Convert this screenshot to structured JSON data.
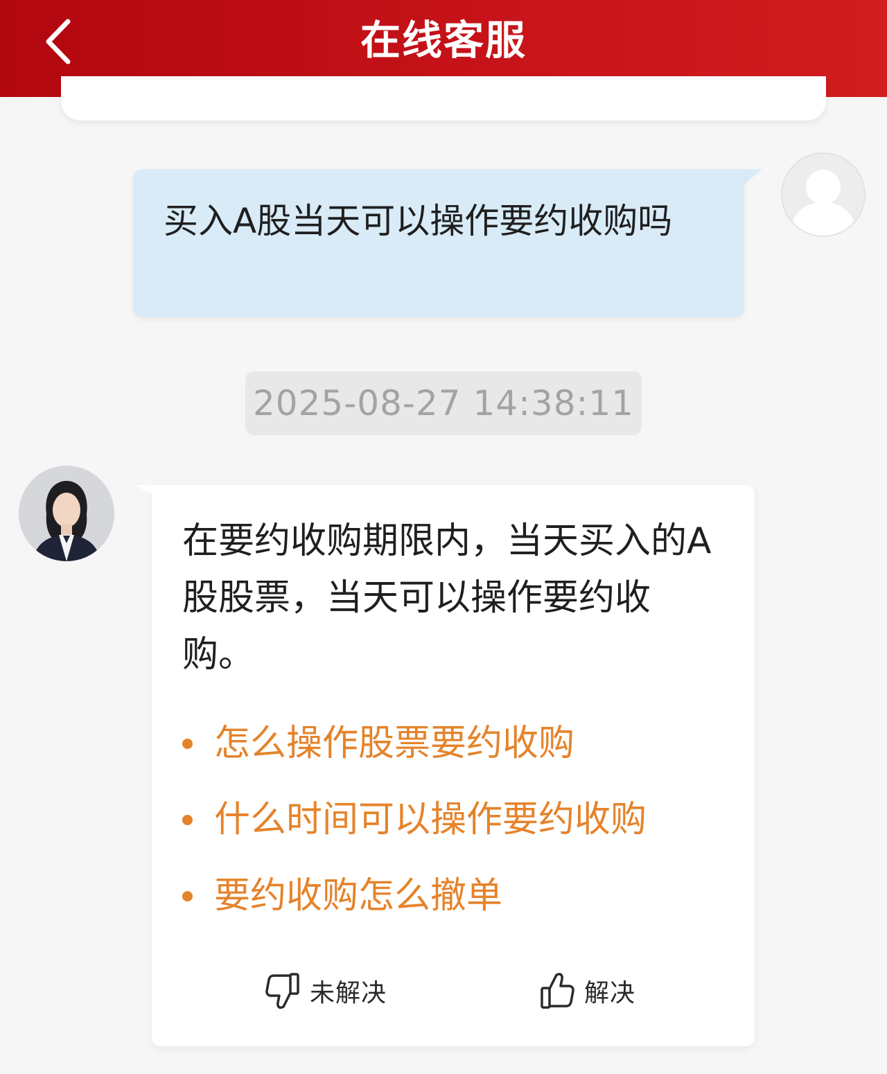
{
  "header": {
    "title": "在线客服",
    "back_icon": "chevron-left-icon"
  },
  "chat": {
    "user_message": "买入A股当天可以操作要约收购吗",
    "timestamp": "2025-08-27 14:38:11",
    "agent_message": "在要约收购期限内，当天买入的A股股票，当天可以操作要约收购。",
    "suggestions": [
      "怎么操作股票要约收购",
      "什么时间可以操作要约收购",
      "要约收购怎么撤单"
    ],
    "feedback": {
      "unsolved_label": "未解决",
      "solved_label": "解决"
    }
  },
  "colors": {
    "header_red": "#c8141a",
    "user_bubble": "#d8ebf6",
    "suggestion_orange": "#e5832b",
    "timestamp_bg": "#e8e8e8"
  }
}
